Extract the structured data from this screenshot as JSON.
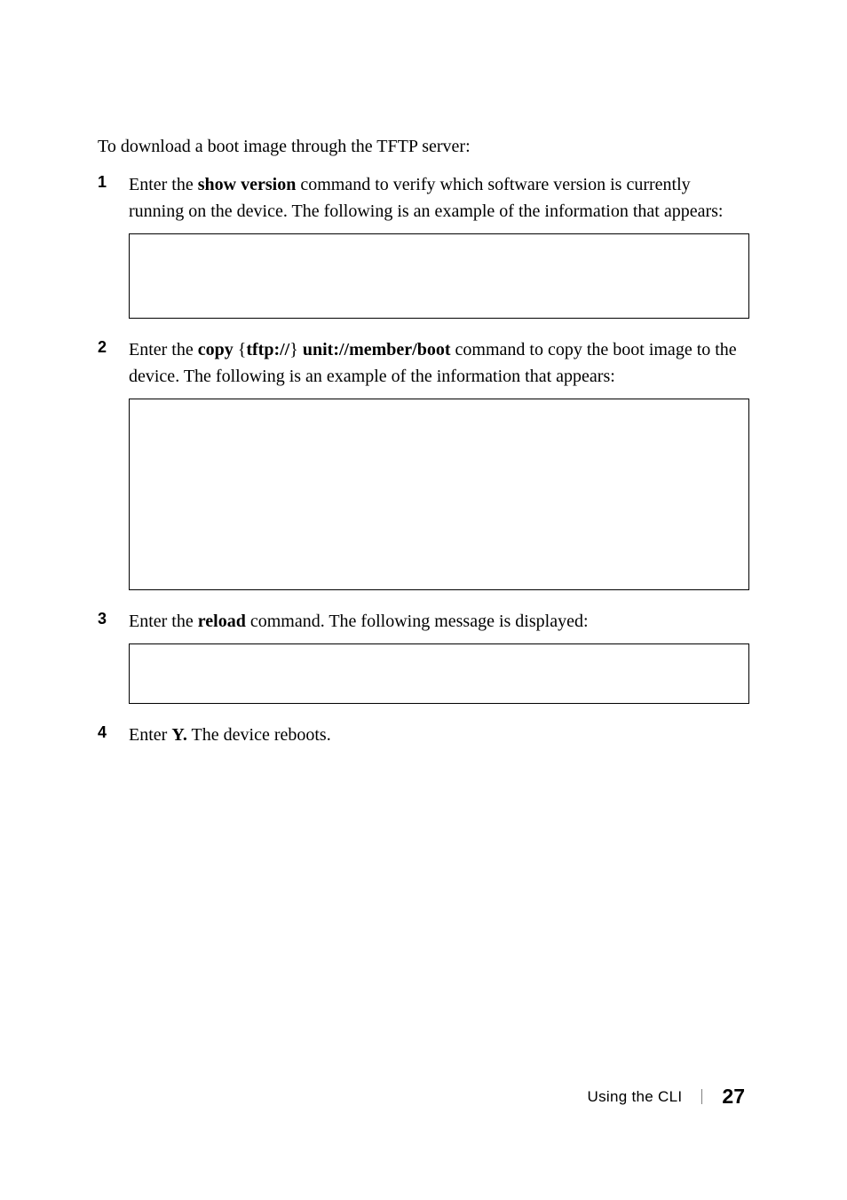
{
  "intro": "To download a boot image through the TFTP server:",
  "steps": [
    {
      "num": "1",
      "prefix": "Enter the ",
      "bold1": "show version",
      "mid": " command to verify which software version is currently running on the device. The following is an example of the information that appears:",
      "hasBox": true,
      "boxClass": "code-box-1"
    },
    {
      "num": "2",
      "prefix": "Enter the ",
      "bold1": "copy ",
      "brace1": "{",
      "boldInner": "tftp://",
      "brace2": "}",
      "bold2": " unit://",
      "boldItalic": "member/boot",
      "mid": " command to copy the boot image to the device. The following is an example of the information that appears:",
      "hasBox": true,
      "boxClass": "code-box-2"
    },
    {
      "num": "3",
      "prefix": "Enter the  ",
      "bold1": "reload",
      "mid": "  command. The following message is displayed:",
      "hasBox": true,
      "boxClass": "code-box-3"
    },
    {
      "num": "4",
      "prefix": "Enter ",
      "bold1": "Y.",
      "mid": " The device reboots.",
      "hasBox": false
    }
  ],
  "footer": {
    "title": "Using the CLI",
    "page": "27"
  }
}
